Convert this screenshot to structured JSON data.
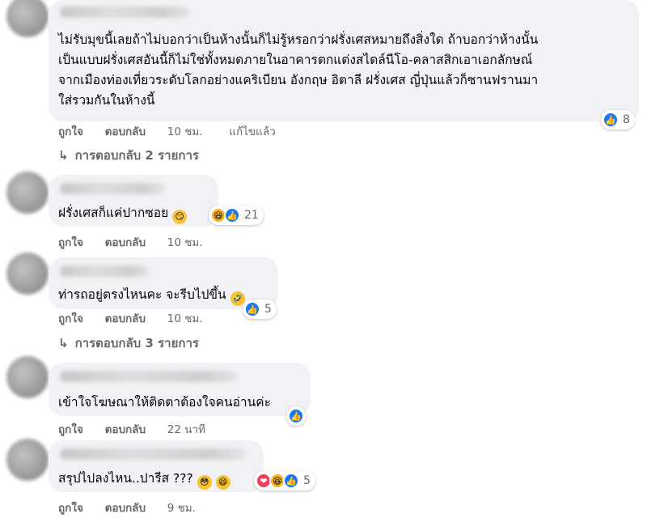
{
  "actions": {
    "like": "ถูกใจ",
    "reply": "ตอบกลับ",
    "edited": "แก้ไขแล้ว"
  },
  "comments": [
    {
      "lines": [
        "ไม่รับมุขนี้เลยถ้าไม่บอกว่าเป็นห้างนั้นก็ไม่รู้หรอกว่าฝรั่งเศสหมายถึงสิ่งใด ถ้าบอกว่าห้างนั้น",
        "เป็นแบบฝรั่งเศสอันนี้ก็ไม่ใช่ทั้งหมดภายในอาคารตกแต่งสไตล์นีโอ-คลาสสิกเอาเอกลักษณ์",
        "จากเมืองท่องเที่ยวระดับโลกอย่างแคริเบียน อังกฤษ อิตาลี ฝรั่งเศส ญี่ปุ่นแล้วก็ซานฟรานมา",
        "ใส่รวมกันในห้างนี้"
      ],
      "time": "10 ชม.",
      "reaction_count": "8",
      "replies": "การตอบกลับ 2 รายการ"
    },
    {
      "text": "ฝรั่งเศสก็แค่ปากซอย",
      "time": "10 ชม.",
      "reaction_count": "21"
    },
    {
      "text": "ท่ารถอยู่ตรงไหนคะ จะรีบไปขึ้น",
      "time": "10 ชม.",
      "reaction_count": "5",
      "replies": "การตอบกลับ 3 รายการ"
    },
    {
      "text": "เข้าใจโฆษณาให้ติดตาต้องใจคนอ่านค่ะ",
      "time": "22 นาที"
    },
    {
      "text": "สรุปไปลงไหน..ปารีส ???",
      "time": "9 ชม.",
      "reaction_count": "5"
    }
  ],
  "icons": {
    "like": "like-icon",
    "haha": "haha-icon",
    "love": "love-icon",
    "reply_arrow": "reply-arrow-icon"
  },
  "colors": {
    "bubble": "#f0f2f5",
    "meta": "#65676b",
    "like": "#1877f2",
    "love": "#f33e58",
    "haha": "#f7b125"
  }
}
